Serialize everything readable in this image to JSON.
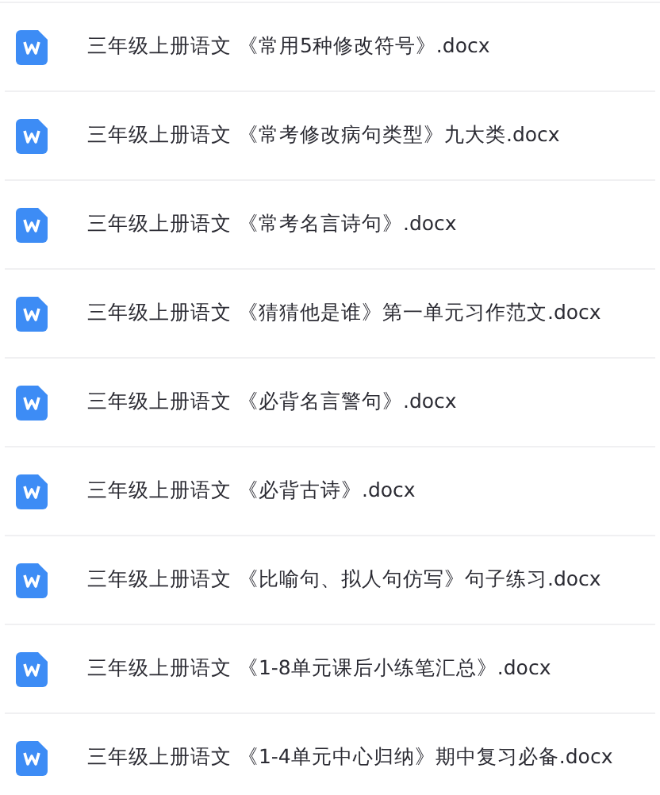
{
  "files": [
    {
      "name": "三年级上册语文 《常用5种修改符号》.docx"
    },
    {
      "name": "三年级上册语文 《常考修改病句类型》九大类.docx"
    },
    {
      "name": "三年级上册语文 《常考名言诗句》.docx"
    },
    {
      "name": "三年级上册语文 《猜猜他是谁》第一单元习作范文.docx"
    },
    {
      "name": "三年级上册语文 《必背名言警句》.docx"
    },
    {
      "name": "三年级上册语文 《必背古诗》.docx"
    },
    {
      "name": "三年级上册语文 《比喻句、拟人句仿写》句子练习.docx"
    },
    {
      "name": "三年级上册语文 《1-8单元课后小练笔汇总》.docx"
    },
    {
      "name": "三年级上册语文 《1-4单元中心归纳》期中复习必备.docx"
    }
  ]
}
